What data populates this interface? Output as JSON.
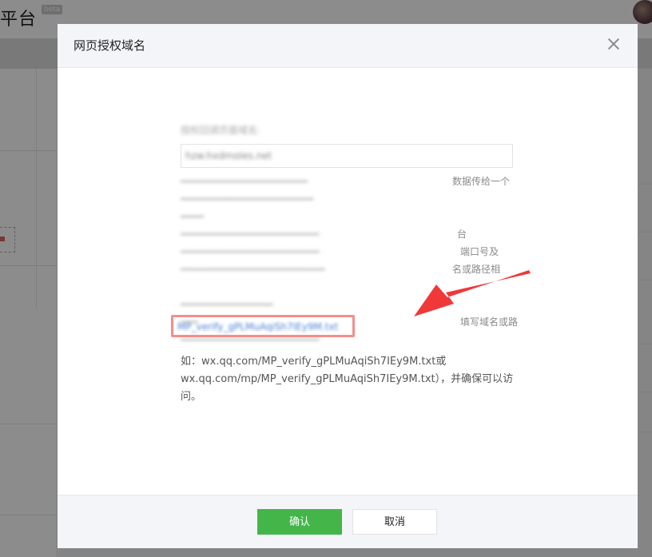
{
  "background": {
    "app_title": "平台",
    "beta_badge": "beta"
  },
  "dialog": {
    "title": "网页授权域名",
    "close_icon": "close-icon",
    "field_label": "授权回调页面域名:",
    "domain_value": "hzw.hxdmoles.net",
    "desc_visible_1": "数据传给一个",
    "desc_visible_2": "台",
    "desc_visible_3": "端口号及",
    "desc_visible_4": "名或路径相",
    "desc_visible_5": "填写域名或路",
    "example_text": "如：wx.qq.com/MP_verify_gPLMuAqiSh7IEy9M.txt或wx.qq.com/mp/MP_verify_gPLMuAqiSh7IEy9M.txt），并确保可以访问。",
    "verify_link": "MP_verify_gPLMuAqiSh7IEy9M.txt",
    "confirm_label": "确认",
    "cancel_label": "取消"
  },
  "colors": {
    "primary": "#44b549",
    "highlight": "#f57878",
    "arrow": "#ee2222"
  }
}
